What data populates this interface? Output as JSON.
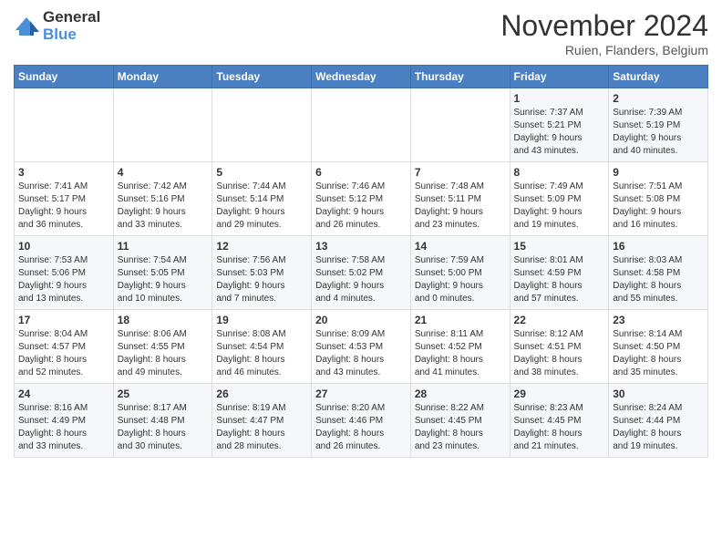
{
  "logo": {
    "general": "General",
    "blue": "Blue"
  },
  "title": "November 2024",
  "location": "Ruien, Flanders, Belgium",
  "headers": [
    "Sunday",
    "Monday",
    "Tuesday",
    "Wednesday",
    "Thursday",
    "Friday",
    "Saturday"
  ],
  "weeks": [
    [
      {
        "day": "",
        "info": ""
      },
      {
        "day": "",
        "info": ""
      },
      {
        "day": "",
        "info": ""
      },
      {
        "day": "",
        "info": ""
      },
      {
        "day": "",
        "info": ""
      },
      {
        "day": "1",
        "info": "Sunrise: 7:37 AM\nSunset: 5:21 PM\nDaylight: 9 hours\nand 43 minutes."
      },
      {
        "day": "2",
        "info": "Sunrise: 7:39 AM\nSunset: 5:19 PM\nDaylight: 9 hours\nand 40 minutes."
      }
    ],
    [
      {
        "day": "3",
        "info": "Sunrise: 7:41 AM\nSunset: 5:17 PM\nDaylight: 9 hours\nand 36 minutes."
      },
      {
        "day": "4",
        "info": "Sunrise: 7:42 AM\nSunset: 5:16 PM\nDaylight: 9 hours\nand 33 minutes."
      },
      {
        "day": "5",
        "info": "Sunrise: 7:44 AM\nSunset: 5:14 PM\nDaylight: 9 hours\nand 29 minutes."
      },
      {
        "day": "6",
        "info": "Sunrise: 7:46 AM\nSunset: 5:12 PM\nDaylight: 9 hours\nand 26 minutes."
      },
      {
        "day": "7",
        "info": "Sunrise: 7:48 AM\nSunset: 5:11 PM\nDaylight: 9 hours\nand 23 minutes."
      },
      {
        "day": "8",
        "info": "Sunrise: 7:49 AM\nSunset: 5:09 PM\nDaylight: 9 hours\nand 19 minutes."
      },
      {
        "day": "9",
        "info": "Sunrise: 7:51 AM\nSunset: 5:08 PM\nDaylight: 9 hours\nand 16 minutes."
      }
    ],
    [
      {
        "day": "10",
        "info": "Sunrise: 7:53 AM\nSunset: 5:06 PM\nDaylight: 9 hours\nand 13 minutes."
      },
      {
        "day": "11",
        "info": "Sunrise: 7:54 AM\nSunset: 5:05 PM\nDaylight: 9 hours\nand 10 minutes."
      },
      {
        "day": "12",
        "info": "Sunrise: 7:56 AM\nSunset: 5:03 PM\nDaylight: 9 hours\nand 7 minutes."
      },
      {
        "day": "13",
        "info": "Sunrise: 7:58 AM\nSunset: 5:02 PM\nDaylight: 9 hours\nand 4 minutes."
      },
      {
        "day": "14",
        "info": "Sunrise: 7:59 AM\nSunset: 5:00 PM\nDaylight: 9 hours\nand 0 minutes."
      },
      {
        "day": "15",
        "info": "Sunrise: 8:01 AM\nSunset: 4:59 PM\nDaylight: 8 hours\nand 57 minutes."
      },
      {
        "day": "16",
        "info": "Sunrise: 8:03 AM\nSunset: 4:58 PM\nDaylight: 8 hours\nand 55 minutes."
      }
    ],
    [
      {
        "day": "17",
        "info": "Sunrise: 8:04 AM\nSunset: 4:57 PM\nDaylight: 8 hours\nand 52 minutes."
      },
      {
        "day": "18",
        "info": "Sunrise: 8:06 AM\nSunset: 4:55 PM\nDaylight: 8 hours\nand 49 minutes."
      },
      {
        "day": "19",
        "info": "Sunrise: 8:08 AM\nSunset: 4:54 PM\nDaylight: 8 hours\nand 46 minutes."
      },
      {
        "day": "20",
        "info": "Sunrise: 8:09 AM\nSunset: 4:53 PM\nDaylight: 8 hours\nand 43 minutes."
      },
      {
        "day": "21",
        "info": "Sunrise: 8:11 AM\nSunset: 4:52 PM\nDaylight: 8 hours\nand 41 minutes."
      },
      {
        "day": "22",
        "info": "Sunrise: 8:12 AM\nSunset: 4:51 PM\nDaylight: 8 hours\nand 38 minutes."
      },
      {
        "day": "23",
        "info": "Sunrise: 8:14 AM\nSunset: 4:50 PM\nDaylight: 8 hours\nand 35 minutes."
      }
    ],
    [
      {
        "day": "24",
        "info": "Sunrise: 8:16 AM\nSunset: 4:49 PM\nDaylight: 8 hours\nand 33 minutes."
      },
      {
        "day": "25",
        "info": "Sunrise: 8:17 AM\nSunset: 4:48 PM\nDaylight: 8 hours\nand 30 minutes."
      },
      {
        "day": "26",
        "info": "Sunrise: 8:19 AM\nSunset: 4:47 PM\nDaylight: 8 hours\nand 28 minutes."
      },
      {
        "day": "27",
        "info": "Sunrise: 8:20 AM\nSunset: 4:46 PM\nDaylight: 8 hours\nand 26 minutes."
      },
      {
        "day": "28",
        "info": "Sunrise: 8:22 AM\nSunset: 4:45 PM\nDaylight: 8 hours\nand 23 minutes."
      },
      {
        "day": "29",
        "info": "Sunrise: 8:23 AM\nSunset: 4:45 PM\nDaylight: 8 hours\nand 21 minutes."
      },
      {
        "day": "30",
        "info": "Sunrise: 8:24 AM\nSunset: 4:44 PM\nDaylight: 8 hours\nand 19 minutes."
      }
    ]
  ]
}
